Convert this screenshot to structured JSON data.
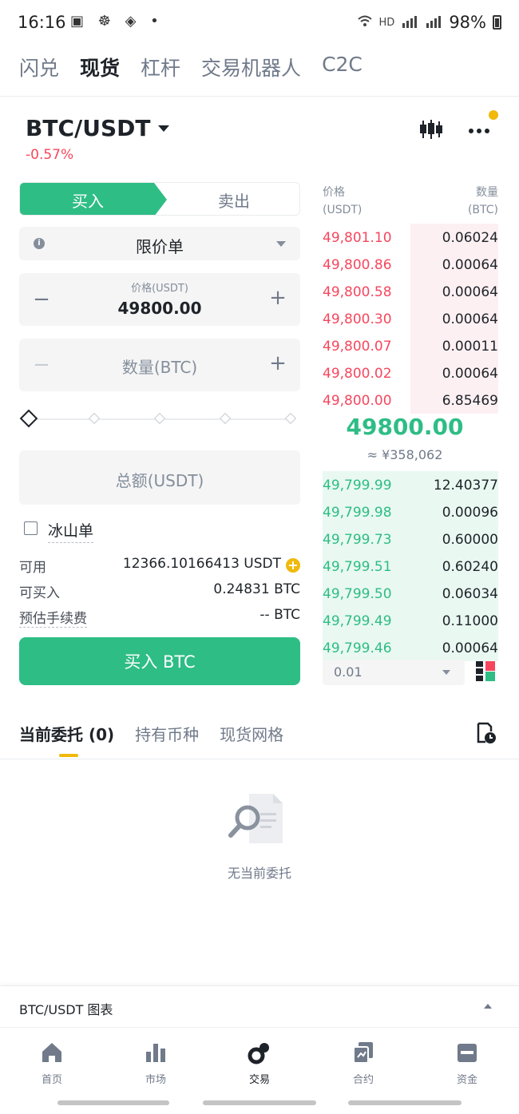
{
  "status_bar": {
    "time": "16:16",
    "left_icons": "▣ ☸ ◈ •",
    "hd": "HD",
    "battery": "98%"
  },
  "top_tabs": [
    {
      "label": "闪兑",
      "active": false
    },
    {
      "label": "现货",
      "active": true
    },
    {
      "label": "杠杆",
      "active": false
    },
    {
      "label": "交易机器人",
      "active": false
    },
    {
      "label": "C2C",
      "active": false
    }
  ],
  "pair": {
    "symbol": "BTC/USDT",
    "change": "-0.57%"
  },
  "trade_panel": {
    "buy_label": "买入",
    "sell_label": "卖出",
    "order_type": "限价单",
    "price_label": "价格(USDT)",
    "price_value": "49800.00",
    "qty_placeholder": "数量(BTC)",
    "total_placeholder": "总额(USDT)",
    "minus": "−",
    "plus": "+",
    "iceberg_label": "冰山单",
    "available_label": "可用",
    "available_value": "12366.10166413 USDT",
    "can_buy_label": "可买入",
    "can_buy_value": "0.24831 BTC",
    "fee_label": "预估手续费",
    "fee_value": "-- BTC",
    "buy_button": "买入 BTC"
  },
  "order_book": {
    "price_header_1": "价格",
    "price_header_2": "(USDT)",
    "qty_header_1": "数量",
    "qty_header_2": "(BTC)",
    "asks": [
      {
        "price": "49,801.10",
        "qty": "0.06024",
        "depth": 0.5
      },
      {
        "price": "49,800.86",
        "qty": "0.00064",
        "depth": 0.5
      },
      {
        "price": "49,800.58",
        "qty": "0.00064",
        "depth": 0.5
      },
      {
        "price": "49,800.30",
        "qty": "0.00064",
        "depth": 0.5
      },
      {
        "price": "49,800.07",
        "qty": "0.00011",
        "depth": 0.5
      },
      {
        "price": "49,800.02",
        "qty": "0.00064",
        "depth": 0.5
      },
      {
        "price": "49,800.00",
        "qty": "6.85469",
        "depth": 0.5
      }
    ],
    "mid_price": "49800.00",
    "mid_fiat": "≈ ¥358,062",
    "bids": [
      {
        "price": "49,799.99",
        "qty": "12.40377",
        "depth": 1.0
      },
      {
        "price": "49,799.98",
        "qty": "0.00096",
        "depth": 1.0
      },
      {
        "price": "49,799.73",
        "qty": "0.60000",
        "depth": 1.0
      },
      {
        "price": "49,799.51",
        "qty": "0.60240",
        "depth": 1.0
      },
      {
        "price": "49,799.50",
        "qty": "0.06034",
        "depth": 1.0
      },
      {
        "price": "49,799.49",
        "qty": "0.11000",
        "depth": 1.0
      },
      {
        "price": "49,799.46",
        "qty": "0.00064",
        "depth": 1.0
      }
    ],
    "depth_value": "0.01"
  },
  "order_tabs": [
    {
      "label": "当前委托 (0)",
      "active": true
    },
    {
      "label": "持有币种",
      "active": false
    },
    {
      "label": "现货网格",
      "active": false
    }
  ],
  "empty_state": "无当前委托",
  "chart_bar_label": "BTC/USDT 图表",
  "bottom_nav": [
    {
      "label": "首页",
      "icon": "home-icon",
      "active": false
    },
    {
      "label": "市场",
      "icon": "market-icon",
      "active": false
    },
    {
      "label": "交易",
      "icon": "trade-icon",
      "active": true
    },
    {
      "label": "合约",
      "icon": "futures-icon",
      "active": false
    },
    {
      "label": "资金",
      "icon": "wallet-icon",
      "active": false
    }
  ],
  "colors": {
    "buy_green": "#2ebd85",
    "sell_red": "#f6465d",
    "accent_yellow": "#f0b90b"
  }
}
